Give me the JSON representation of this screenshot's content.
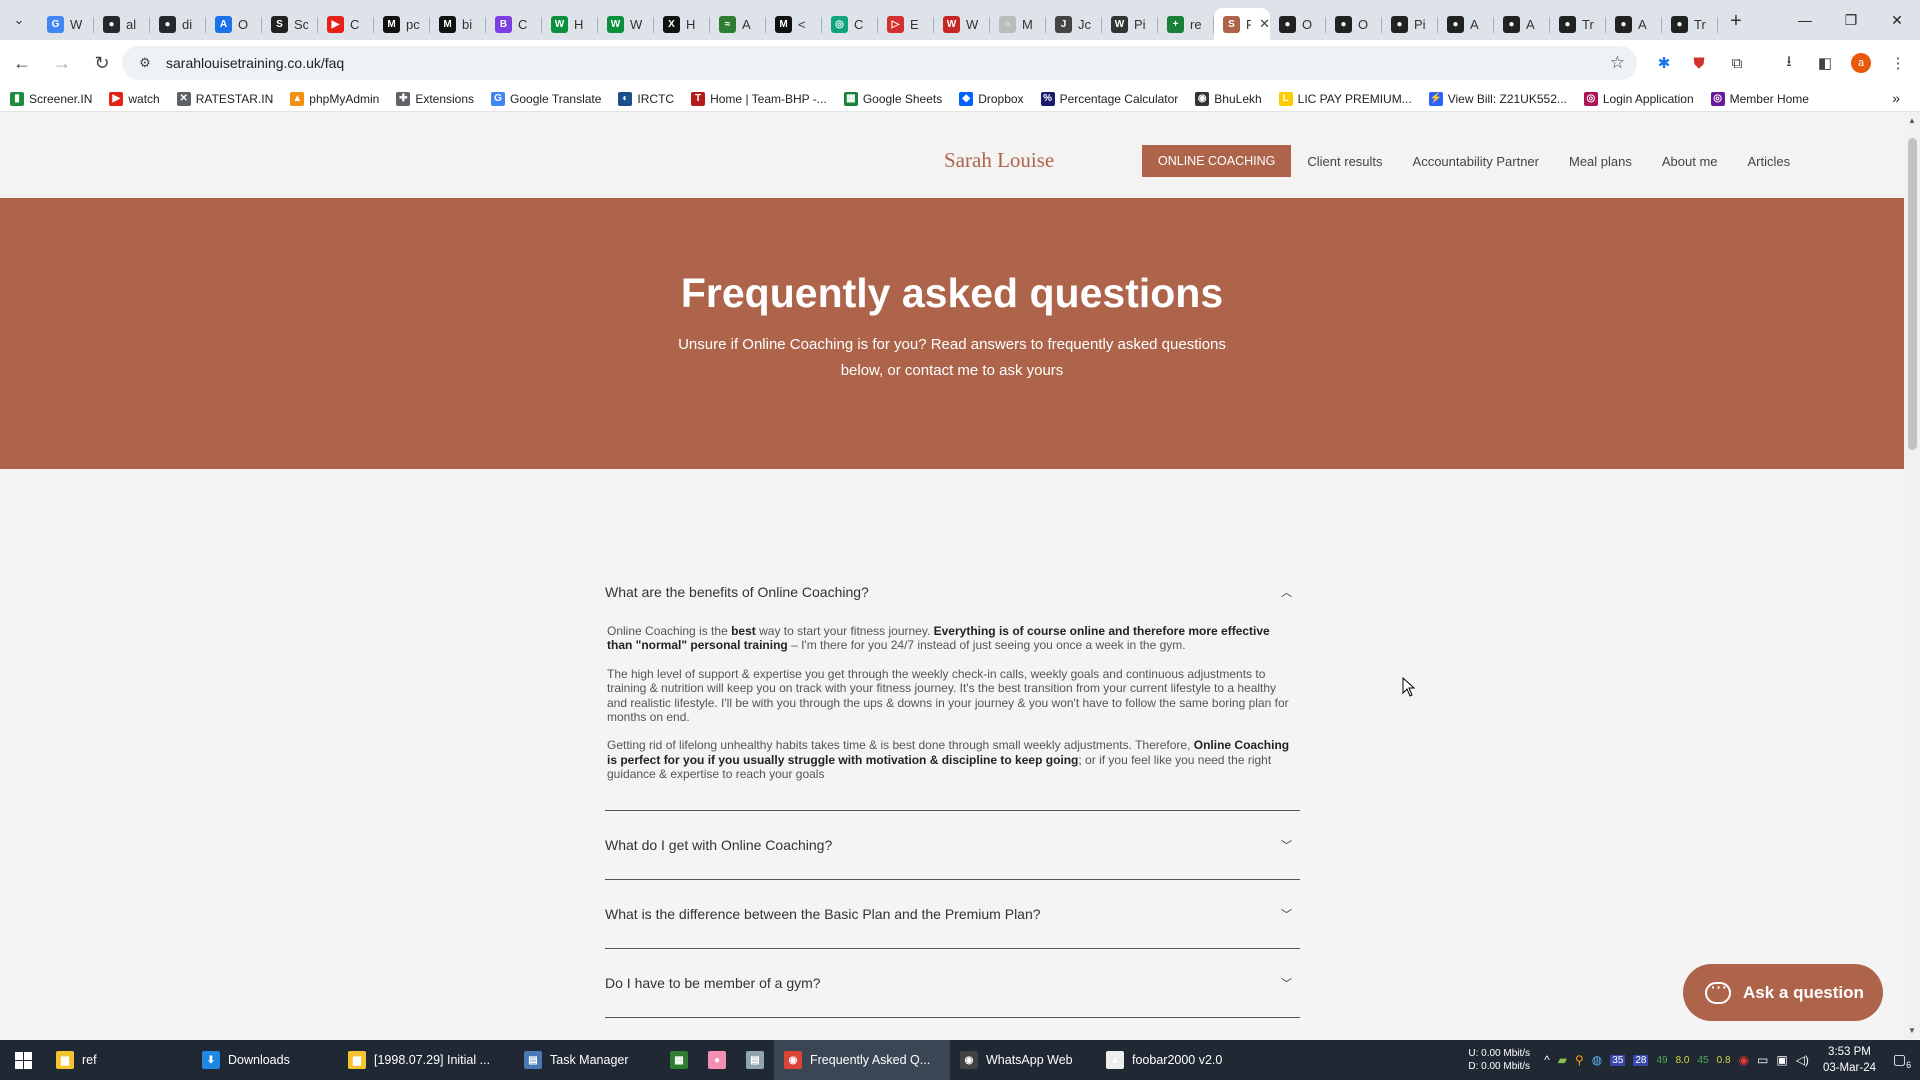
{
  "browser": {
    "tabs": [
      {
        "label": "W",
        "color": "#4285f4",
        "glyph": "G"
      },
      {
        "label": "al",
        "color": "#24292e",
        "glyph": "●"
      },
      {
        "label": "di",
        "color": "#24292e",
        "glyph": "●"
      },
      {
        "label": "O",
        "color": "#1a73e8",
        "glyph": "A"
      },
      {
        "label": "Sc",
        "color": "#222222",
        "glyph": "S"
      },
      {
        "label": "C",
        "color": "#e62117",
        "glyph": "▶"
      },
      {
        "label": "pc",
        "color": "#111111",
        "glyph": "M"
      },
      {
        "label": "bi",
        "color": "#111111",
        "glyph": "M"
      },
      {
        "label": "C",
        "color": "#7b3fe4",
        "glyph": "B"
      },
      {
        "label": "H",
        "color": "#0a8f3c",
        "glyph": "W"
      },
      {
        "label": "W",
        "color": "#0a8f3c",
        "glyph": "W"
      },
      {
        "label": "H",
        "color": "#111111",
        "glyph": "X"
      },
      {
        "label": "A",
        "color": "#2e7d32",
        "glyph": "≈"
      },
      {
        "label": "<",
        "color": "#111111",
        "glyph": "M"
      },
      {
        "label": "C",
        "color": "#10a37f",
        "glyph": "◎"
      },
      {
        "label": "E",
        "color": "#d32f2f",
        "glyph": "▷"
      },
      {
        "label": "W",
        "color": "#c62828",
        "glyph": "W"
      },
      {
        "label": "M",
        "color": "#bbbbbb",
        "glyph": "○"
      },
      {
        "label": "Jc",
        "color": "#444444",
        "glyph": "J"
      },
      {
        "label": "Pi",
        "color": "#333333",
        "glyph": "W"
      },
      {
        "label": "re",
        "color": "#188038",
        "glyph": "+"
      },
      {
        "label": "Fr",
        "color": "#ad644b",
        "glyph": "S",
        "active": true
      },
      {
        "label": "O",
        "color": "#222222",
        "glyph": "●"
      },
      {
        "label": "O",
        "color": "#222222",
        "glyph": "●"
      },
      {
        "label": "Pi",
        "color": "#222222",
        "glyph": "●"
      },
      {
        "label": "A",
        "color": "#222222",
        "glyph": "●"
      },
      {
        "label": "A",
        "color": "#222222",
        "glyph": "●"
      },
      {
        "label": "Tr",
        "color": "#222222",
        "glyph": "●"
      },
      {
        "label": "A",
        "color": "#222222",
        "glyph": "●"
      },
      {
        "label": "Tr",
        "color": "#222222",
        "glyph": "●"
      }
    ],
    "url": "sarahlouisetraining.co.uk/faq",
    "bookmarks": [
      {
        "label": "Screener.IN",
        "color": "#1e8e3e",
        "glyph": "▮"
      },
      {
        "label": "watch",
        "color": "#e62117",
        "glyph": "▶"
      },
      {
        "label": "RATESTAR.IN",
        "color": "#5f6368",
        "glyph": "✕"
      },
      {
        "label": "phpMyAdmin",
        "color": "#f29111",
        "glyph": "▲"
      },
      {
        "label": "Extensions",
        "color": "#5f6368",
        "glyph": "✚"
      },
      {
        "label": "Google Translate",
        "color": "#4285f4",
        "glyph": "G"
      },
      {
        "label": "IRCTC",
        "color": "#1a4f8b",
        "glyph": "◐"
      },
      {
        "label": "Home | Team-BHP -...",
        "color": "#b71c1c",
        "glyph": "T"
      },
      {
        "label": "Google Sheets",
        "color": "#188038",
        "glyph": "▦"
      },
      {
        "label": "Dropbox",
        "color": "#0061fe",
        "glyph": "◆"
      },
      {
        "label": "Percentage Calculator",
        "color": "#1a1a6e",
        "glyph": "%"
      },
      {
        "label": "BhuLekh",
        "color": "#333333",
        "glyph": "◉"
      },
      {
        "label": "LIC PAY PREMIUM...",
        "color": "#ffcc00",
        "glyph": "L"
      },
      {
        "label": "View Bill: Z21UK552...",
        "color": "#2962ff",
        "glyph": "⚡"
      },
      {
        "label": "Login Application",
        "color": "#ad1457",
        "glyph": "◎"
      },
      {
        "label": "Member Home",
        "color": "#6a1b9a",
        "glyph": "◎"
      }
    ]
  },
  "site": {
    "brand": "Sarah Louise",
    "nav": [
      "ONLINE COACHING",
      "Client results",
      "Accountability Partner",
      "Meal plans",
      "About me",
      "Articles"
    ],
    "hero": {
      "title": "Frequently asked questions",
      "subtitle": "Unsure if Online Coaching is for you? Read answers to frequently asked questions below, or contact me to ask yours"
    },
    "faq": {
      "open": {
        "question": "What are the benefits of Online Coaching?",
        "p1": {
          "t1": "Online Coaching is the ",
          "b1": "best",
          "t2": " way to start your fitness journey. ",
          "b2": "Everything is of course online and therefore more effective than \"normal\" personal training",
          "t3": " – I'm there for you 24/7 instead of just seeing you once a week in the gym."
        },
        "p2": "The high level of support & expertise you get through the weekly check-in calls, weekly goals and continuous adjustments to training & nutrition will keep you on track with your fitness journey. It's the best transition from your current lifestyle to a healthy and realistic lifestyle. I'll be with you through the ups & downs in your journey & you won't have to follow the same boring plan for months on end.",
        "p3": {
          "t1": "Getting rid of lifelong unhealthy habits takes time & is best done through small weekly adjustments. Therefore, ",
          "b1": "Online Coaching is perfect for you if you usually struggle with motivation & discipline to keep going",
          "t2": "; or if you feel like you need the right guidance & expertise to reach your goals"
        }
      },
      "closed": [
        "What do I get with Online Coaching?",
        "What is the difference between the Basic Plan and the Premium Plan?",
        "Do I have to be member of a gym?"
      ]
    },
    "ask_button": "Ask a question"
  },
  "taskbar": {
    "items": [
      {
        "label": "ref",
        "color": "#f4c430",
        "glyph": "▆"
      },
      {
        "label": "Downloads",
        "color": "#1e88e5",
        "glyph": "⬇"
      },
      {
        "label": "[1998.07.29] Initial ...",
        "color": "#f4c430",
        "glyph": "▆"
      },
      {
        "label": "Task Manager",
        "color": "#4a7ab5",
        "glyph": "▤"
      },
      {
        "label": "",
        "color": "#2e7d32",
        "glyph": "▦"
      },
      {
        "label": "",
        "color": "#f48fb1",
        "glyph": "●"
      },
      {
        "label": "",
        "color": "#90a4ae",
        "glyph": "▤"
      },
      {
        "label": "Frequently Asked Q...",
        "color": "#db4437",
        "glyph": "◉",
        "active": true
      },
      {
        "label": "WhatsApp Web",
        "color": "#424242",
        "glyph": "◉"
      },
      {
        "label": "foobar2000 v2.0",
        "color": "#eeeeee",
        "glyph": "▲"
      }
    ],
    "net_up": "U:  0.00 Mbit/s",
    "net_down": "D:  0.00 Mbit/s",
    "tray_numbers": [
      "35",
      "28",
      "49",
      "8.0",
      "45",
      "0.8"
    ],
    "time": "3:53 PM",
    "date": "03-Mar-24",
    "notifications": "6"
  }
}
